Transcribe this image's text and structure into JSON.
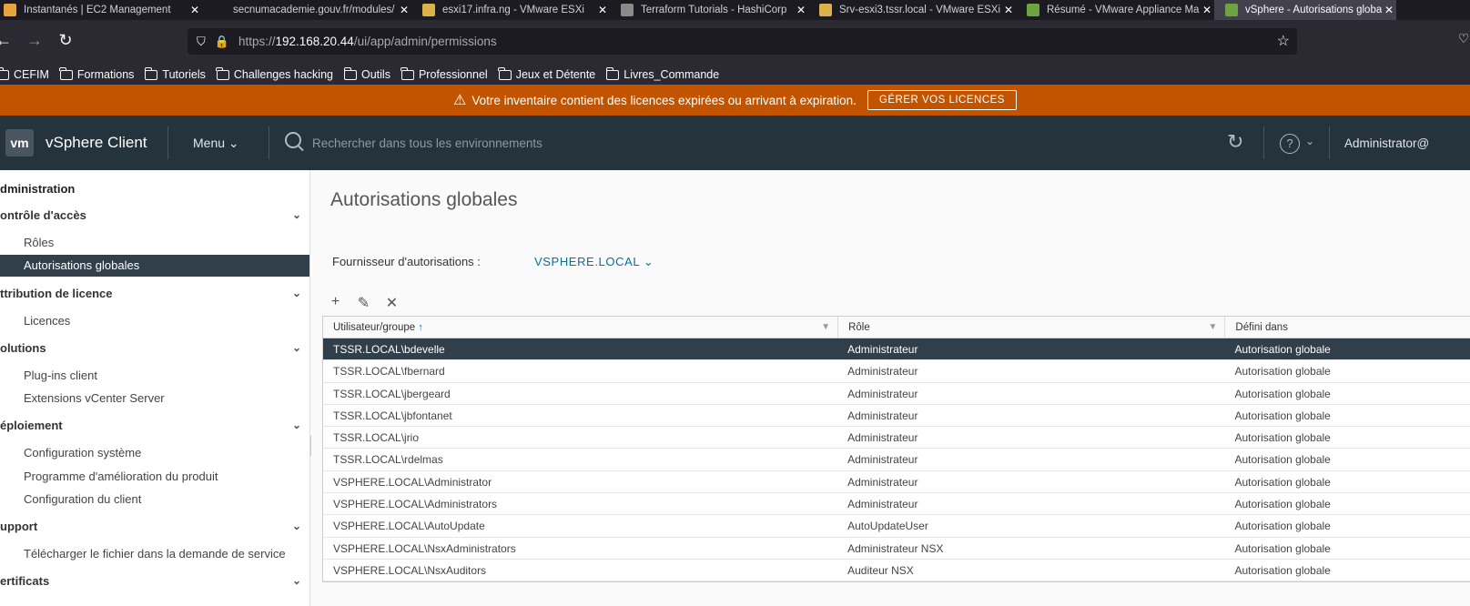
{
  "browser": {
    "tabs": [
      {
        "label": "Instantanés | EC2 Management",
        "color": "#e8a33c"
      },
      {
        "label": "secnumacademie.gouv.fr/modules/",
        "color": ""
      },
      {
        "label": "esxi17.infra.ng - VMware ESXi",
        "color": "#d9b24a"
      },
      {
        "label": "Terraform Tutorials - HashiCorp",
        "color": "#8a8a8a"
      },
      {
        "label": "Srv-esxi3.tssr.local - VMware ESXi",
        "color": "#d9b24a"
      },
      {
        "label": "Résumé - VMware Appliance Management",
        "color": "#6da441"
      },
      {
        "label": "vSphere - Autorisations globales",
        "color": "#6da441"
      }
    ],
    "url_prefix": "https://",
    "url_host": "192.168.20.44",
    "url_path": "/ui/app/admin/permissions",
    "bookmarks": [
      "CEFIM",
      "Formations",
      "Tutoriels",
      "Challenges hacking",
      "Outils",
      "Professionnel",
      "Jeux et Détente",
      "Livres_Commande"
    ]
  },
  "banner": {
    "message": "Votre inventaire contient des licences expirées ou arrivant à expiration.",
    "button": "GÉRER VOS LICENCES",
    "color": "#c25400"
  },
  "header": {
    "logo": "vm",
    "app_name": "vSphere Client",
    "menu": "Menu",
    "search_placeholder": "Rechercher dans tous les environnements",
    "user": "Administrator@"
  },
  "sidebar": {
    "title": "dministration",
    "sections": [
      {
        "label": "ontrôle d'accès",
        "items": [
          "Rôles",
          "Autorisations globales"
        ]
      },
      {
        "label": "ttribution de licence",
        "items": [
          "Licences"
        ]
      },
      {
        "label": "olutions",
        "items": [
          "Plug-ins client",
          "Extensions vCenter Server"
        ]
      },
      {
        "label": "éploiement",
        "items": [
          "Configuration système",
          "Programme d'amélioration du produit",
          "Configuration du client"
        ]
      },
      {
        "label": "upport",
        "items": [
          "Télécharger le fichier dans la demande de service"
        ]
      },
      {
        "label": "ertificats",
        "items": []
      }
    ],
    "active_item": "Autorisations globales"
  },
  "main": {
    "title": "Autorisations globales",
    "provider_label": "Fournisseur d'autorisations :",
    "provider_value": "VSPHERE.LOCAL",
    "columns": [
      "Utilisateur/groupe",
      "Rôle",
      "Défini dans"
    ],
    "rows": [
      [
        "TSSR.LOCAL\\bdevelle",
        "Administrateur",
        "Autorisation globale"
      ],
      [
        "TSSR.LOCAL\\fbernard",
        "Administrateur",
        "Autorisation globale"
      ],
      [
        "TSSR.LOCAL\\jbergeard",
        "Administrateur",
        "Autorisation globale"
      ],
      [
        "TSSR.LOCAL\\jbfontanet",
        "Administrateur",
        "Autorisation globale"
      ],
      [
        "TSSR.LOCAL\\jrio",
        "Administrateur",
        "Autorisation globale"
      ],
      [
        "TSSR.LOCAL\\rdelmas",
        "Administrateur",
        "Autorisation globale"
      ],
      [
        "VSPHERE.LOCAL\\Administrator",
        "Administrateur",
        "Autorisation globale"
      ],
      [
        "VSPHERE.LOCAL\\Administrators",
        "Administrateur",
        "Autorisation globale"
      ],
      [
        "VSPHERE.LOCAL\\AutoUpdate",
        "AutoUpdateUser",
        "Autorisation globale"
      ],
      [
        "VSPHERE.LOCAL\\NsxAdministrators",
        "Administrateur NSX",
        "Autorisation globale"
      ],
      [
        "VSPHERE.LOCAL\\NsxAuditors",
        "Auditeur NSX",
        "Autorisation globale"
      ]
    ],
    "selected_row": 0
  }
}
